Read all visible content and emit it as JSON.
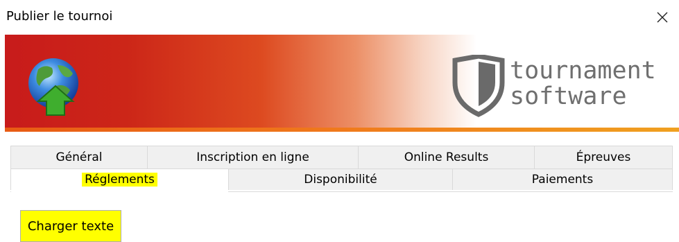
{
  "window": {
    "title": "Publier le tournoi"
  },
  "banner": {
    "logo_line1": "tournament",
    "logo_line2": "software",
    "gradient_start": "#c81b1b",
    "stripe_color": "#f07a1c"
  },
  "tabs": {
    "back_row": [
      {
        "label": "Général"
      },
      {
        "label": "Inscription en ligne"
      },
      {
        "label": "Online Results"
      },
      {
        "label": "Épreuves"
      }
    ],
    "front_row": [
      {
        "label": "Réglements",
        "active": true,
        "highlighted": true
      },
      {
        "label": "Disponibilité"
      },
      {
        "label": "Paiements"
      }
    ]
  },
  "content": {
    "charger_button_label": "Charger texte",
    "highlight_color": "#ffff00"
  },
  "icons": {
    "close": "close-icon",
    "globe": "globe-upload-icon",
    "logo": "shield-logo-icon"
  }
}
